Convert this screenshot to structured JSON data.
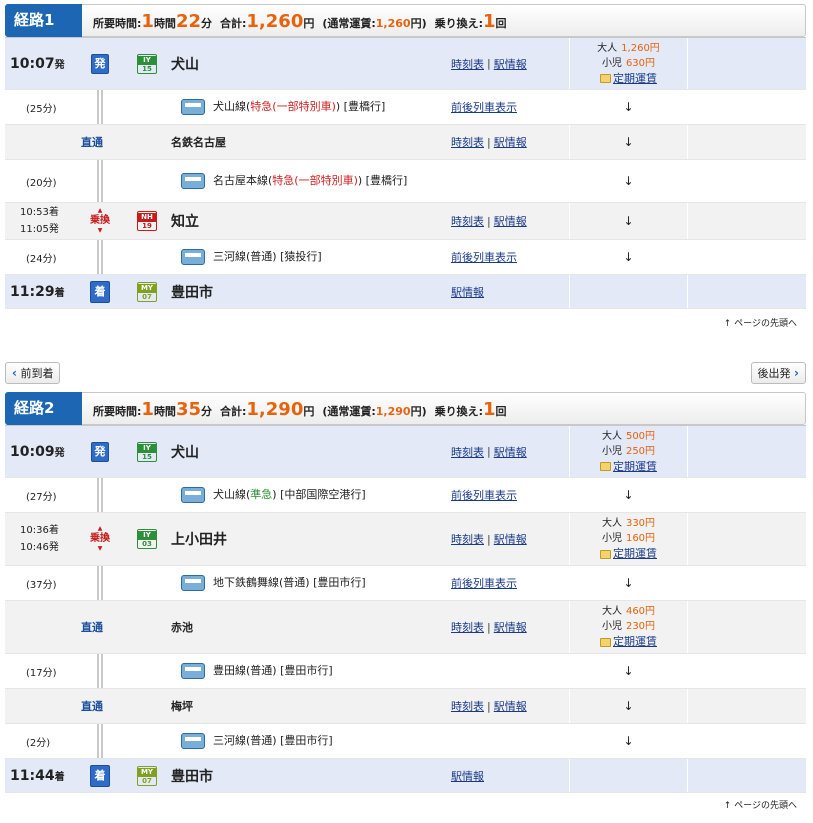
{
  "page_top": "ページの先頭へ",
  "nav": {
    "prev": "前到着",
    "next": "後出発"
  },
  "routes": [
    {
      "tag": "経路1",
      "summary": {
        "label_time": "所要時間:",
        "h": "1",
        "h_unit": "時間",
        "m": "22",
        "m_unit": "分",
        "label_total": "合計:",
        "total": "1,260",
        "yen": "円",
        "normal_label": "(通常運賃:",
        "normal": "1,260",
        "normal_end": "円)",
        "xfer_label": "乗り換え:",
        "xfer": "1",
        "xfer_unit": "回"
      },
      "rows": [
        {
          "kind": "station",
          "bg": "blue",
          "time": "10:07",
          "suffix": "発",
          "icon": "発",
          "code": [
            "IY",
            "15"
          ],
          "codecolor": "iy",
          "name": "犬山",
          "links": [
            "時刻表",
            "駅情報"
          ],
          "fare": {
            "adult_label": "大人",
            "adult": "1,260円",
            "child_label": "小児",
            "child": "630円",
            "pass": "定期運賃"
          },
          "h": 52
        },
        {
          "kind": "train",
          "bg": "wht",
          "dur": "(25分)",
          "line": [
            {
              "t": "犬山線("
            },
            {
              "t": "特急(一部特別車)",
              "c": "red"
            },
            {
              "t": ")  [豊橋行]"
            }
          ],
          "link": "前後列車表示",
          "arrow": "↓",
          "h": 35
        },
        {
          "kind": "direct",
          "bg": "gray",
          "label": "直通",
          "name": "名鉄名古屋",
          "links": [
            "時刻表",
            "駅情報"
          ],
          "arrow": "↓",
          "h": 35
        },
        {
          "kind": "train",
          "bg": "wht",
          "dur": "(20分)",
          "line": [
            {
              "t": "名古屋本線("
            },
            {
              "t": "特急(一部特別車)",
              "c": "red"
            },
            {
              "t": ")  [豊橋行]"
            }
          ],
          "link": "",
          "arrow": "↓",
          "h": 43
        },
        {
          "kind": "xfer",
          "bg": "gray",
          "t1": "10:53着",
          "t2": "11:05発",
          "xfer": "乗換",
          "code": [
            "NH",
            "19"
          ],
          "codecolor": "nh",
          "name": "知立",
          "links": [
            "時刻表",
            "駅情報"
          ],
          "arrow": "↓",
          "h": 37
        },
        {
          "kind": "train",
          "bg": "wht",
          "dur": "(24分)",
          "line": [
            {
              "t": "三河線(普通)  [猿投行]"
            }
          ],
          "link": "前後列車表示",
          "arrow": "↓",
          "h": 35
        },
        {
          "kind": "arrive",
          "bg": "blue",
          "time": "11:29",
          "suffix": "着",
          "icon": "着",
          "code": [
            "MY",
            "07"
          ],
          "codecolor": "my",
          "name": "豊田市",
          "links": [
            "駅情報"
          ],
          "h": 34
        }
      ]
    },
    {
      "tag": "経路2",
      "summary": {
        "label_time": "所要時間:",
        "h": "1",
        "h_unit": "時間",
        "m": "35",
        "m_unit": "分",
        "label_total": "合計:",
        "total": "1,290",
        "yen": "円",
        "normal_label": "(通常運賃:",
        "normal": "1,290",
        "normal_end": "円)",
        "xfer_label": "乗り換え:",
        "xfer": "1",
        "xfer_unit": "回"
      },
      "rows": [
        {
          "kind": "station",
          "bg": "blue",
          "time": "10:09",
          "suffix": "発",
          "icon": "発",
          "code": [
            "IY",
            "15"
          ],
          "codecolor": "iy",
          "name": "犬山",
          "links": [
            "時刻表",
            "駅情報"
          ],
          "fare": {
            "adult_label": "大人",
            "adult": "500円",
            "child_label": "小児",
            "child": "250円",
            "pass": "定期運賃"
          },
          "h": 52
        },
        {
          "kind": "train",
          "bg": "wht",
          "dur": "(27分)",
          "line": [
            {
              "t": "犬山線("
            },
            {
              "t": "準急",
              "c": "grn"
            },
            {
              "t": ")  [中部国際空港行]"
            }
          ],
          "link": "前後列車表示",
          "arrow": "↓",
          "h": 35
        },
        {
          "kind": "xfer",
          "bg": "gray",
          "t1": "10:36着",
          "t2": "10:46発",
          "xfer": "乗換",
          "code": [
            "IY",
            "03"
          ],
          "codecolor": "iy",
          "name": "上小田井",
          "links": [
            "時刻表",
            "駅情報"
          ],
          "fare": {
            "adult_label": "大人",
            "adult": "330円",
            "child_label": "小児",
            "child": "160円",
            "pass": "定期運賃"
          },
          "h": 53
        },
        {
          "kind": "train",
          "bg": "wht",
          "dur": "(37分)",
          "line": [
            {
              "t": "地下鉄鶴舞線(普通)  [豊田市行]"
            }
          ],
          "link": "前後列車表示",
          "arrow": "↓",
          "h": 35
        },
        {
          "kind": "direct",
          "bg": "gray",
          "label": "直通",
          "name": "赤池",
          "links": [
            "時刻表",
            "駅情報"
          ],
          "fare": {
            "adult_label": "大人",
            "adult": "460円",
            "child_label": "小児",
            "child": "230円",
            "pass": "定期運賃"
          },
          "h": 53
        },
        {
          "kind": "train",
          "bg": "wht",
          "dur": "(17分)",
          "line": [
            {
              "t": "豊田線(普通)  [豊田市行]"
            }
          ],
          "link": "",
          "arrow": "↓",
          "h": 35
        },
        {
          "kind": "direct",
          "bg": "gray",
          "label": "直通",
          "name": "梅坪",
          "links": [
            "時刻表",
            "駅情報"
          ],
          "arrow": "↓",
          "h": 35
        },
        {
          "kind": "train",
          "bg": "wht",
          "dur": "(2分)",
          "line": [
            {
              "t": "三河線(普通)  [豊田市行]"
            }
          ],
          "link": "",
          "arrow": "↓",
          "h": 35
        },
        {
          "kind": "arrive",
          "bg": "blue",
          "time": "11:44",
          "suffix": "着",
          "icon": "着",
          "code": [
            "MY",
            "07"
          ],
          "codecolor": "my",
          "name": "豊田市",
          "links": [
            "駅情報"
          ],
          "h": 34
        }
      ]
    }
  ]
}
